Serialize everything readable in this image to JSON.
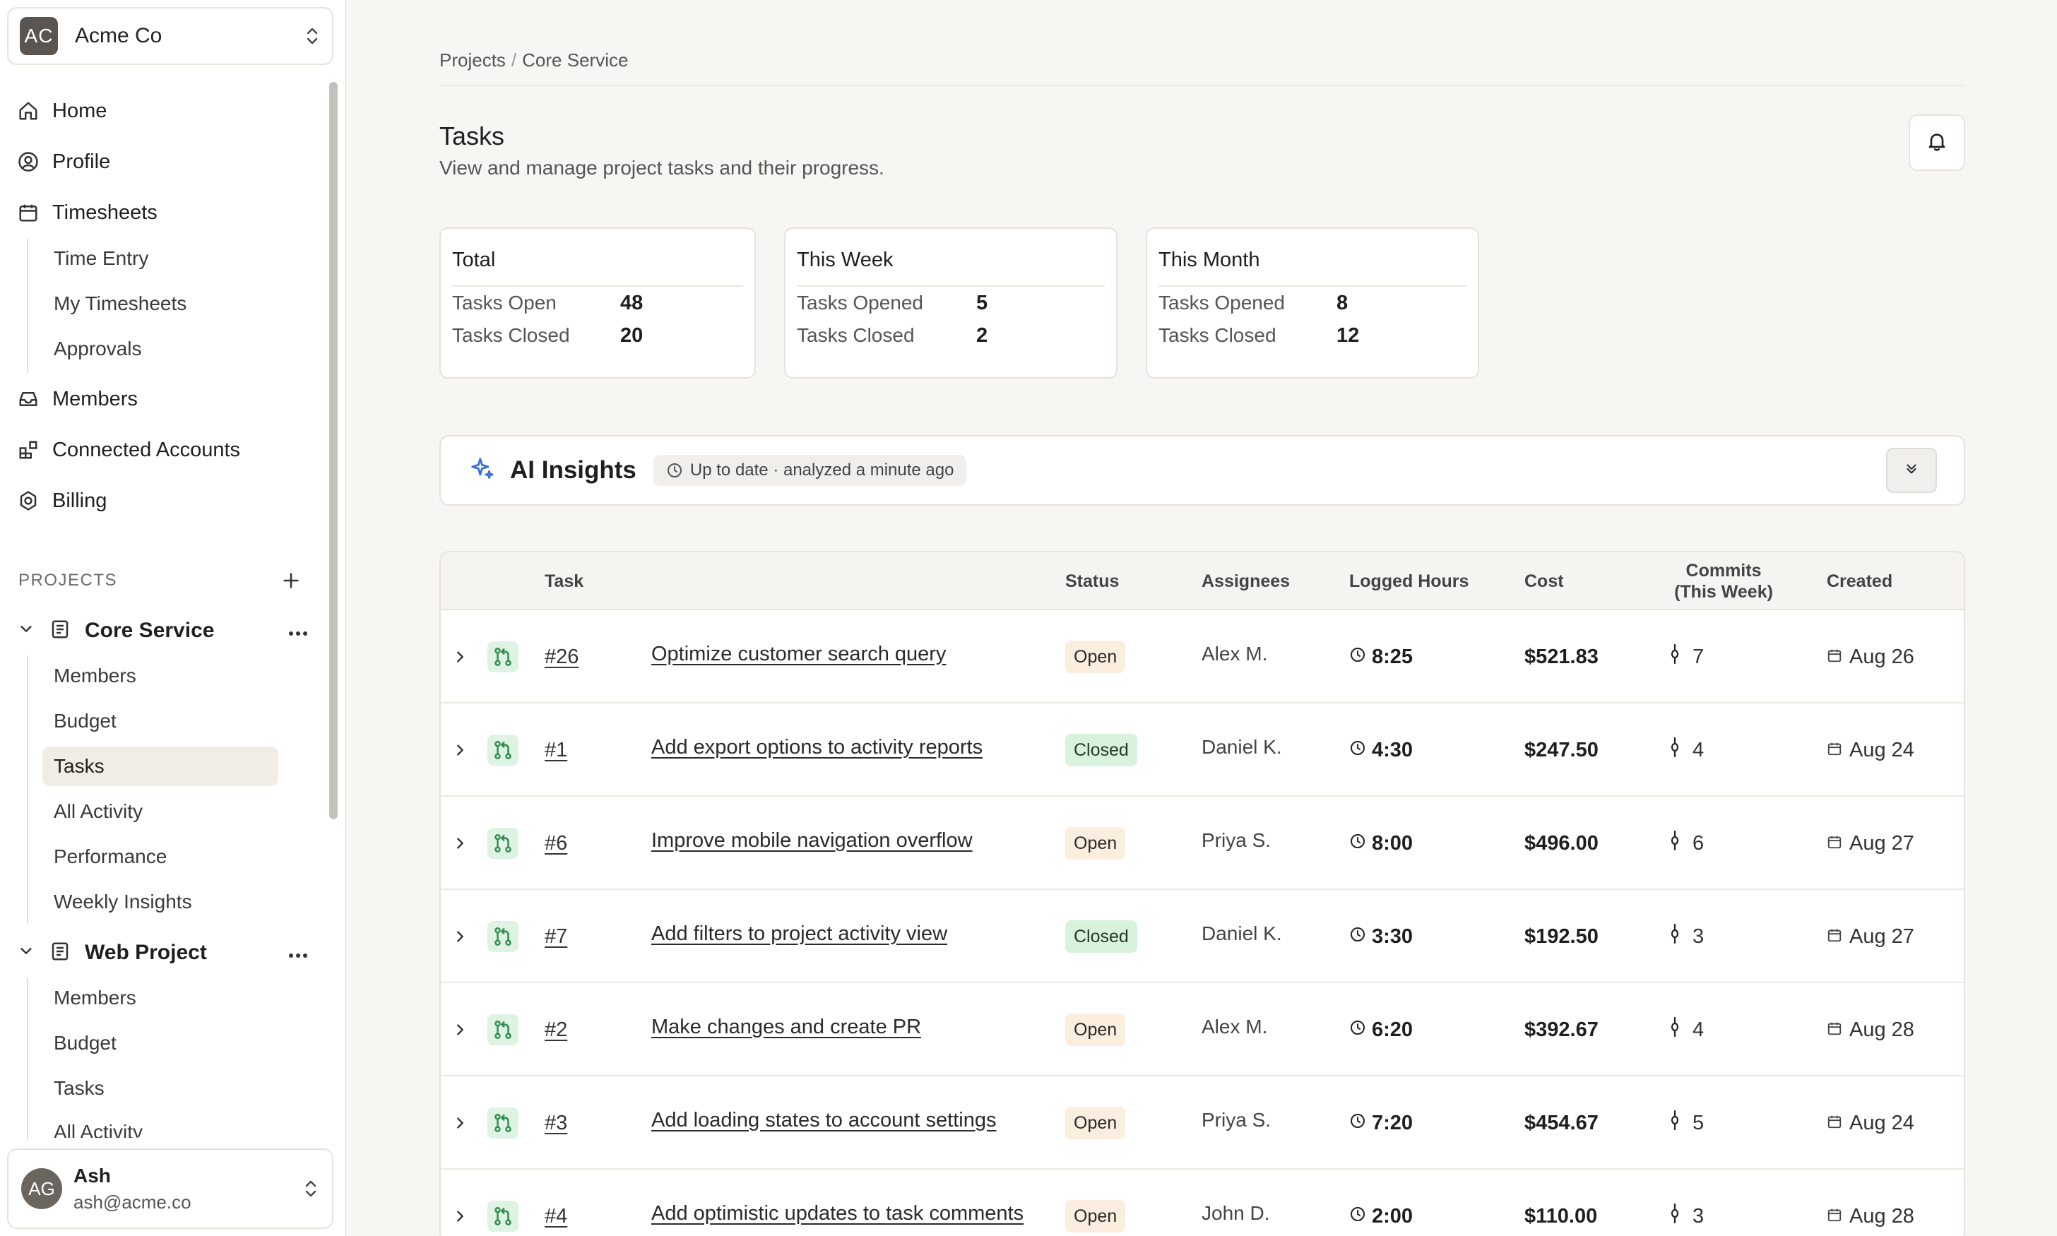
{
  "org": {
    "initials": "AC",
    "name": "Acme Co"
  },
  "nav": {
    "home": "Home",
    "profile": "Profile",
    "timesheets": "Timesheets",
    "timesheets_sub": [
      "Time Entry",
      "My Timesheets",
      "Approvals"
    ],
    "members": "Members",
    "connected_accounts": "Connected Accounts",
    "billing": "Billing"
  },
  "projects": {
    "label": "PROJECTS",
    "core": {
      "name": "Core Service",
      "items": [
        "Members",
        "Budget",
        "Tasks",
        "All Activity",
        "Performance",
        "Weekly Insights"
      ],
      "active": "Tasks"
    },
    "web": {
      "name": "Web Project",
      "items": [
        "Members",
        "Budget",
        "Tasks",
        "All Activity"
      ]
    }
  },
  "user": {
    "initials": "AG",
    "name": "Ash",
    "email": "ash@acme.co"
  },
  "breadcrumb": {
    "root": "Projects",
    "sep": "/",
    "current": "Core Service"
  },
  "page": {
    "title": "Tasks",
    "subtitle": "View and manage project tasks and their progress."
  },
  "stats": {
    "total": {
      "title": "Total",
      "l1": "Tasks Open",
      "v1": "48",
      "l2": "Tasks Closed",
      "v2": "20"
    },
    "week": {
      "title": "This Week",
      "l1": "Tasks Opened",
      "v1": "5",
      "l2": "Tasks Closed",
      "v2": "2"
    },
    "month": {
      "title": "This Month",
      "l1": "Tasks Opened",
      "v1": "8",
      "l2": "Tasks Closed",
      "v2": "12"
    }
  },
  "insights": {
    "title": "AI Insights",
    "status": "Up to date · analyzed a minute ago"
  },
  "table": {
    "headers": {
      "task": "Task",
      "status": "Status",
      "assignees": "Assignees",
      "hours": "Logged Hours",
      "cost": "Cost",
      "commits_1": "Commits",
      "commits_2": "(This Week)",
      "created": "Created"
    },
    "rows": [
      {
        "id": "#26",
        "name": "Optimize customer search query",
        "status": "Open",
        "assignee": "Alex M.",
        "hours": "8:25",
        "cost": "$521.83",
        "commits": "7",
        "created": "Aug 26"
      },
      {
        "id": "#1",
        "name": "Add export options to activity reports",
        "status": "Closed",
        "assignee": "Daniel K.",
        "hours": "4:30",
        "cost": "$247.50",
        "commits": "4",
        "created": "Aug 24"
      },
      {
        "id": "#6",
        "name": "Improve mobile navigation overflow",
        "status": "Open",
        "assignee": "Priya S.",
        "hours": "8:00",
        "cost": "$496.00",
        "commits": "6",
        "created": "Aug 27"
      },
      {
        "id": "#7",
        "name": "Add filters to project activity view",
        "status": "Closed",
        "assignee": "Daniel K.",
        "hours": "3:30",
        "cost": "$192.50",
        "commits": "3",
        "created": "Aug 27"
      },
      {
        "id": "#2",
        "name": "Make changes and create PR",
        "status": "Open",
        "assignee": "Alex M.",
        "hours": "6:20",
        "cost": "$392.67",
        "commits": "4",
        "created": "Aug 28"
      },
      {
        "id": "#3",
        "name": "Add loading states to account settings",
        "status": "Open",
        "assignee": "Priya S.",
        "hours": "7:20",
        "cost": "$454.67",
        "commits": "5",
        "created": "Aug 24"
      },
      {
        "id": "#4",
        "name": "Add optimistic updates to task comments",
        "status": "Open",
        "assignee": "John D.",
        "hours": "2:00",
        "cost": "$110.00",
        "commits": "3",
        "created": "Aug 28"
      }
    ]
  },
  "colors": {
    "background": "#f8f6f3",
    "open_badge": "#fbeede",
    "closed_badge": "#d9f2de",
    "pr_icon": "#2f8f4e",
    "ai_icon": "#3b6fd8"
  },
  "icons": [
    "home-icon",
    "profile-icon",
    "calendar-icon",
    "inbox-icon",
    "apps-icon",
    "billing-icon",
    "bell-icon",
    "sparkle-icon",
    "clock-icon",
    "pull-request-icon",
    "commit-icon",
    "calendar-small-icon"
  ]
}
